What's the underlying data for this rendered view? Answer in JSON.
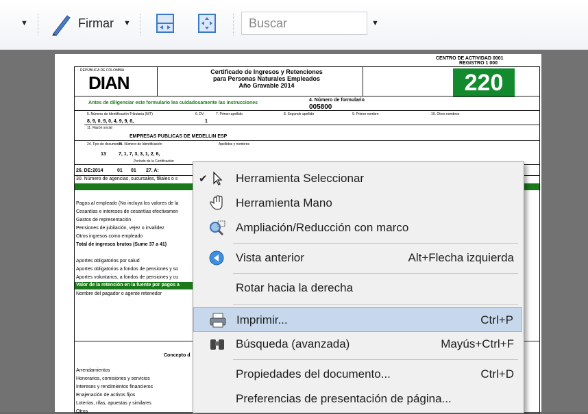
{
  "toolbar": {
    "sign_label": "Firmar",
    "search_placeholder": "Buscar",
    "dropdown_glyph": "▼"
  },
  "document": {
    "center_label": "CENTRO DE ACTIVIDAD 0001",
    "register_label": "REGISTRO 1 000",
    "dian_republica": "REPÚBLICA DE COLOMBIA",
    "dian_logo": "DIAN",
    "title_line1": "Certificado de Ingresos y Retenciones",
    "title_line2": "para Personas Naturales Empleados",
    "title_line3": "Año Gravable 2014",
    "form_number": "220",
    "form_num_label": "4. Número de formulario",
    "form_num_value": "005800",
    "instructions": "Antes de diligenciar este formulario lea cuidadosamente las instrucciones",
    "nit_label": "5. Número de Identificación Tributaria (NIT)",
    "dv_label": "6. DV",
    "surname1": "7. Primer apellido",
    "surname2": "8. Segundo apellido",
    "name1": "9. Primer nombre",
    "name2": "10. Otros nombres",
    "nit_value": "8, 9, 0, 9, 0, 4, 9, 9, 6,",
    "dv_value": "1",
    "razon_label": "11. Razón social",
    "razon_value": "EMPRESAS PUBLICAS DE MEDELLIN ESP",
    "doc_type_label": "24. Tipo de documento",
    "doc_type_value": "13",
    "id_label": "25. Número de Identificación",
    "id_value": "7, 1, 7, 3, 3, 1, 2, 6,",
    "apellidos_label": "Apellidos y nombres",
    "period_label": "Período de la Certificación",
    "period_de": "26. DE:",
    "year": "2014",
    "month1": "01",
    "day1": "01",
    "a_label": "27. A:",
    "row_agencias": "30. Número de agencias, sucursales, filiales o s",
    "rows": [
      "Pagos al empleado (No incluya los valores de la",
      "Cesantías e intereses de cesantías efectivamen",
      "Gastos de representación",
      "Pensiones de jubilación, vejez o invalidez",
      "Otros ingresos como empleado",
      "Total de ingresos brutos (Sume 37 a 41)",
      "",
      "Aportes obligatorios por salud",
      "Aportes obligatorios a fondos de pensiones y so",
      "Aportes voluntarios, a fondos de pensiones y cu",
      "Valor de la retención en la fuente por pagos a",
      "Nombre del pagador o agente retenedor"
    ],
    "concept_label": "Concepto d",
    "bottom_rows": [
      "Arrendamientos",
      "Honorarios, comisiones y servicios",
      "Intereses y rendimientos financieros",
      "Enajenación de activos fijos",
      "Loterías, rifas, apuestas y similares",
      "Otros"
    ]
  },
  "context_menu": {
    "items": [
      {
        "label": "Herramienta Seleccionar",
        "shortcut": "",
        "checked": true,
        "icon": "arrow-cursor-icon"
      },
      {
        "label": "Herramienta Mano",
        "shortcut": "",
        "icon": "hand-icon"
      },
      {
        "label": "Ampliación/Reducción con marco",
        "shortcut": "",
        "icon": "marquee-zoom-icon"
      },
      {
        "label": "Vista anterior",
        "shortcut": "Alt+Flecha izquierda",
        "icon": "back-arrow-icon"
      },
      {
        "label": "Rotar hacia la derecha",
        "shortcut": ""
      },
      {
        "label": "Imprimir...",
        "shortcut": "Ctrl+P",
        "icon": "printer-icon",
        "highlighted": true
      },
      {
        "label": "Búsqueda (avanzada)",
        "shortcut": "Mayús+Ctrl+F",
        "icon": "binoculars-icon"
      },
      {
        "label": "Propiedades del documento...",
        "shortcut": "Ctrl+D"
      },
      {
        "label": "Preferencias de presentación de página...",
        "shortcut": ""
      }
    ],
    "check_glyph": "✔"
  },
  "colors": {
    "menu_highlight": "#c7d8ec",
    "form_green": "#138a2e",
    "viewer_bg": "#727272"
  }
}
